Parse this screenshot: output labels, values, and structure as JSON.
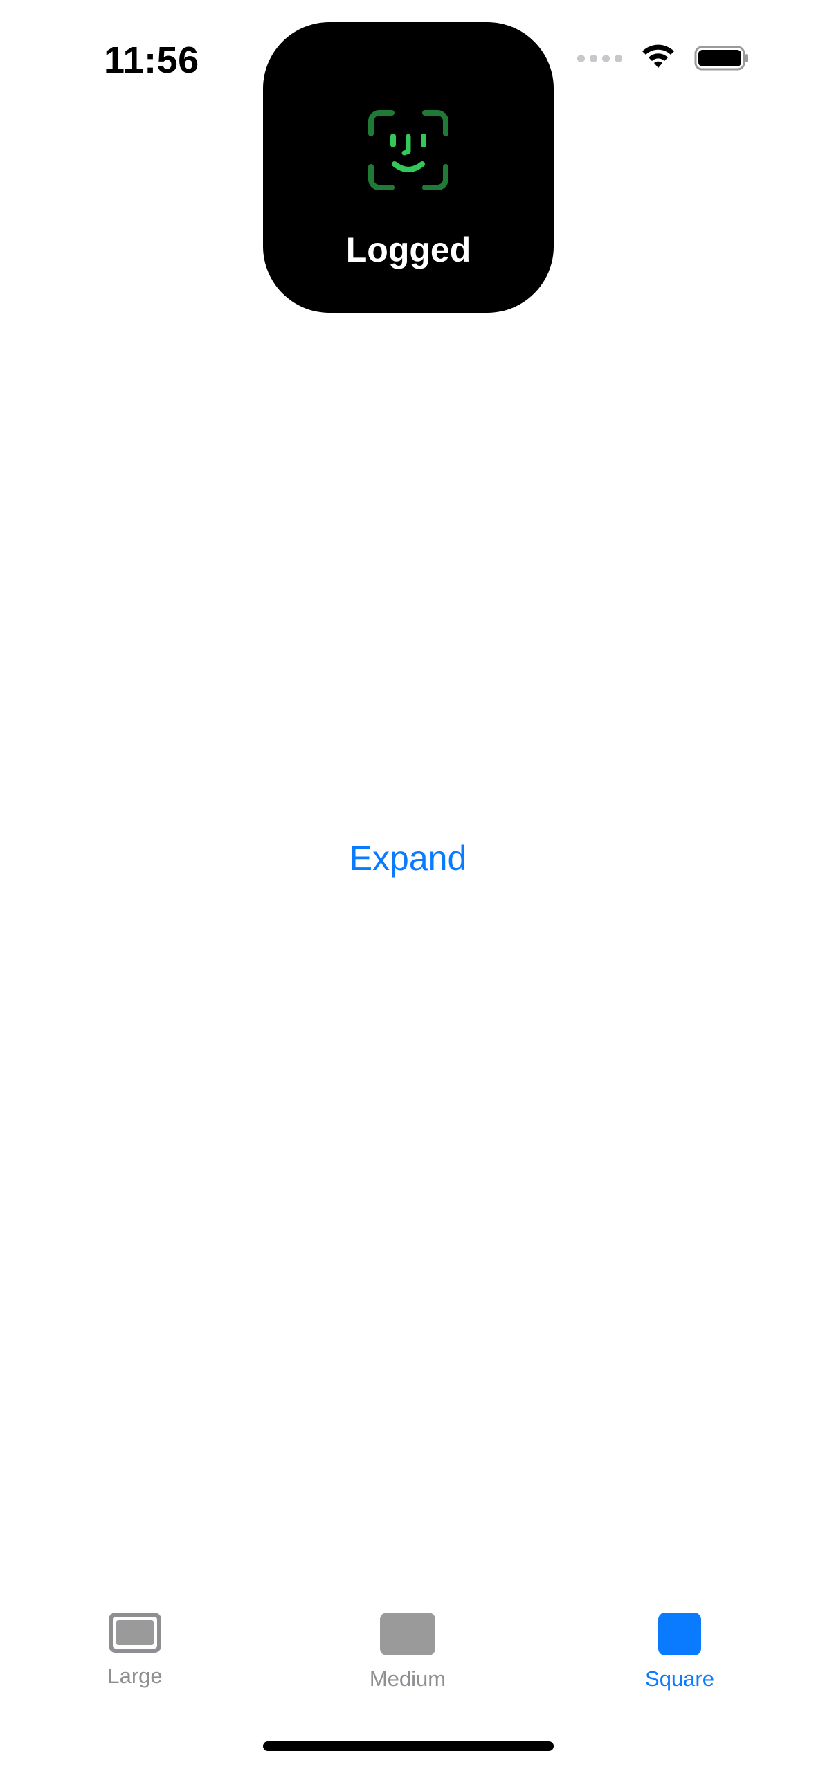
{
  "status_bar": {
    "time": "11:56",
    "wifi_icon": "wifi-icon",
    "battery_icon": "battery-icon",
    "signal_icon": "cellular-signal-icon"
  },
  "island": {
    "icon": "face-id-icon",
    "label": "Logged",
    "icon_color": "#34c759"
  },
  "main": {
    "expand_label": "Expand"
  },
  "tabbar": {
    "tabs": [
      {
        "label": "Large",
        "icon": "large-rect-icon",
        "active": false
      },
      {
        "label": "Medium",
        "icon": "medium-rect-icon",
        "active": false
      },
      {
        "label": "Square",
        "icon": "square-icon",
        "active": true
      }
    ]
  },
  "colors": {
    "accent": "#0a7aff",
    "inactive": "#8e8e93"
  }
}
